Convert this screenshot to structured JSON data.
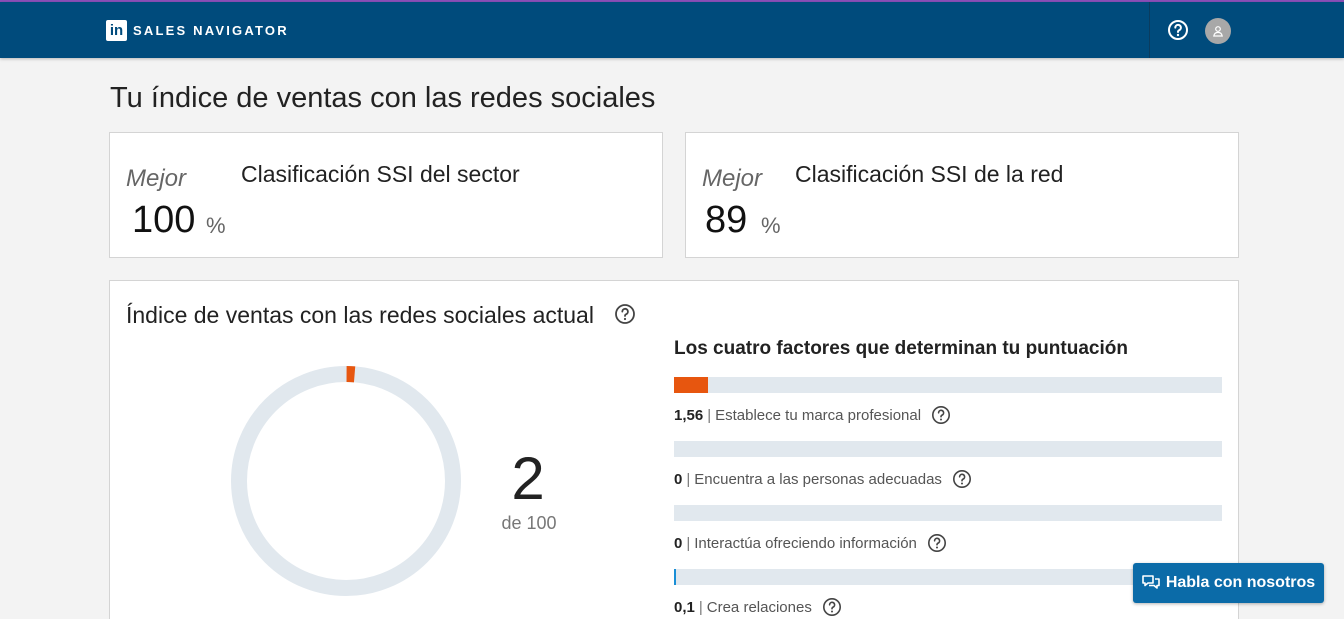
{
  "header": {
    "logo_text": "in",
    "brand": "SALES NAVIGATOR",
    "help_icon": "help-circle-icon",
    "avatar_icon": "user-avatar-icon"
  },
  "page": {
    "title": "Tu índice de ventas con las redes sociales"
  },
  "rankings": [
    {
      "label": "Mejor",
      "value": "100",
      "unit": "%",
      "title": "Clasificación SSI del sector"
    },
    {
      "label": "Mejor",
      "value": "89",
      "unit": "%",
      "title": "Clasificación SSI de la red"
    }
  ],
  "current": {
    "title": "Índice de ventas con las redes sociales actual",
    "score": "2",
    "score_of": "de 100",
    "score_fraction": 0.02,
    "factors_title": "Los cuatro factores que determinan tu puntuación",
    "factors": [
      {
        "value": "1,56",
        "label": "Establece tu marca profesional",
        "fraction": 0.0624,
        "color": "#e7560f"
      },
      {
        "value": "0",
        "label": "Encuentra a las personas adecuadas",
        "fraction": 0,
        "color": "#8c6bb1"
      },
      {
        "value": "0",
        "label": "Interactúa ofreciendo información",
        "fraction": 0,
        "color": "#2e9c8f"
      },
      {
        "value": "0,1",
        "label": "Crea relaciones",
        "fraction": 0.004,
        "color": "#1a8fd6"
      }
    ]
  },
  "chat": {
    "label": "Habla con nosotros",
    "icon": "chat-bubbles-icon"
  },
  "colors": {
    "navbar": "#004b7c",
    "accent_top": "#8b4fb8",
    "score_segment": "#e7560f",
    "track": "#e1e8ee",
    "chat_button": "#0b6ba8"
  }
}
